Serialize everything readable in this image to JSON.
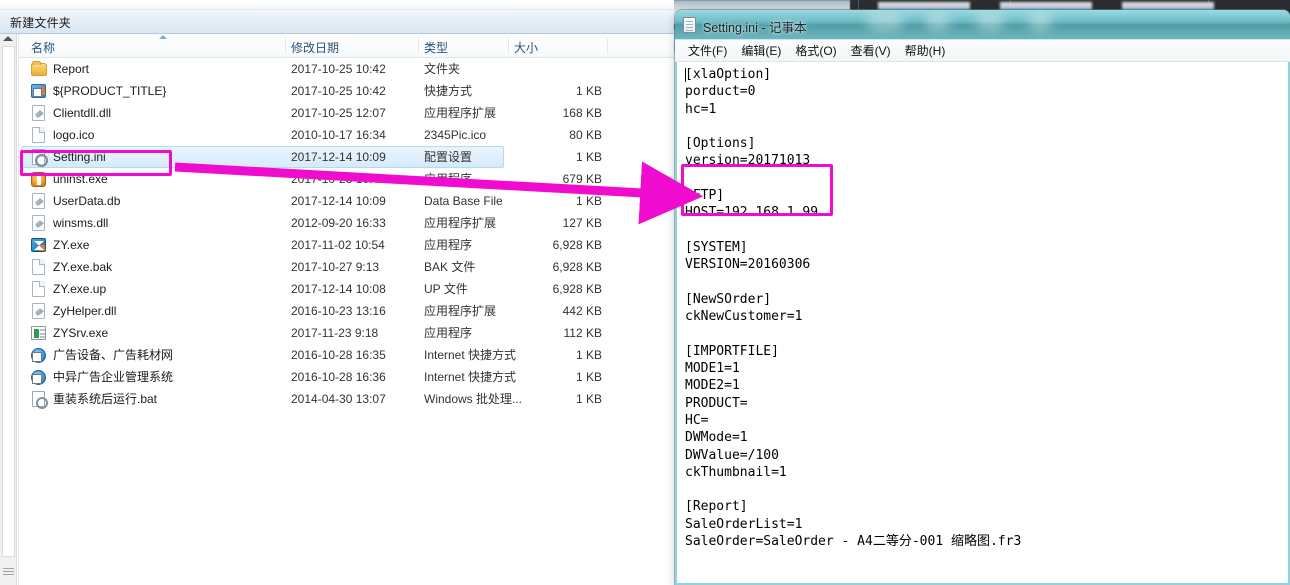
{
  "explorer": {
    "window_name": "file-explorer",
    "breadcrumb": "新建文件夹",
    "columns": [
      {
        "key": "name",
        "label": "名称"
      },
      {
        "key": "date",
        "label": "修改日期"
      },
      {
        "key": "type",
        "label": "类型"
      },
      {
        "key": "size",
        "label": "大小"
      }
    ],
    "sort_column": "名称",
    "sort_direction": "ascending",
    "rows": [
      {
        "icon": "folder-icon",
        "icon_class": "folder",
        "name": "Report",
        "date": "2017-10-25 10:42",
        "type": "文件夹",
        "size": "",
        "selected": false
      },
      {
        "icon": "shortcut-icon",
        "icon_class": "shortcut",
        "name": "${PRODUCT_TITLE}",
        "date": "2017-10-25 10:42",
        "type": "快捷方式",
        "size": "1 KB",
        "selected": false
      },
      {
        "icon": "dll-file-icon",
        "icon_class": "dll",
        "name": "Clientdll.dll",
        "date": "2017-10-25 12:07",
        "type": "应用程序扩展",
        "size": "168 KB",
        "selected": false
      },
      {
        "icon": "generic-file-icon",
        "icon_class": "doc",
        "name": "logo.ico",
        "date": "2010-10-17 16:34",
        "type": "2345Pic.ico",
        "size": "80 KB",
        "selected": false
      },
      {
        "icon": "ini-settings-icon",
        "icon_class": "gear",
        "name": "Setting.ini",
        "date": "2017-12-14 10:09",
        "type": "配置设置",
        "size": "1 KB",
        "selected": true
      },
      {
        "icon": "uninstall-app-icon",
        "icon_class": "app-uninst",
        "name": "uninst.exe",
        "date": "2017-10-25 10:42",
        "type": "应用程序",
        "size": "679 KB",
        "selected": false
      },
      {
        "icon": "dll-file-icon",
        "icon_class": "dll",
        "name": "UserData.db",
        "date": "2017-12-14 10:09",
        "type": "Data Base File",
        "size": "1 KB",
        "selected": false
      },
      {
        "icon": "dll-file-icon",
        "icon_class": "dll",
        "name": "winsms.dll",
        "date": "2012-09-20 16:33",
        "type": "应用程序扩展",
        "size": "127 KB",
        "selected": false
      },
      {
        "icon": "zy-app-icon",
        "icon_class": "zy",
        "name": "ZY.exe",
        "date": "2017-11-02 10:54",
        "type": "应用程序",
        "size": "6,928 KB",
        "selected": false
      },
      {
        "icon": "generic-file-icon",
        "icon_class": "doc",
        "name": "ZY.exe.bak",
        "date": "2017-10-27 9:13",
        "type": "BAK 文件",
        "size": "6,928 KB",
        "selected": false
      },
      {
        "icon": "generic-file-icon",
        "icon_class": "doc",
        "name": "ZY.exe.up",
        "date": "2017-12-14 10:08",
        "type": "UP 文件",
        "size": "6,928 KB",
        "selected": false
      },
      {
        "icon": "dll-file-icon",
        "icon_class": "dll",
        "name": "ZyHelper.dll",
        "date": "2016-10-23 13:16",
        "type": "应用程序扩展",
        "size": "442 KB",
        "selected": false
      },
      {
        "icon": "server-app-icon",
        "icon_class": "srv",
        "name": "ZYSrv.exe",
        "date": "2017-11-23 9:18",
        "type": "应用程序",
        "size": "112 KB",
        "selected": false
      },
      {
        "icon": "internet-shortcut-icon",
        "icon_class": "inet",
        "name": "广告设备、广告耗材网",
        "date": "2016-10-28 16:35",
        "type": "Internet 快捷方式",
        "size": "1 KB",
        "selected": false
      },
      {
        "icon": "internet-shortcut-icon",
        "icon_class": "inet",
        "name": "中异广告企业管理系统",
        "date": "2016-10-28 16:36",
        "type": "Internet 快捷方式",
        "size": "1 KB",
        "selected": false
      },
      {
        "icon": "batch-file-icon",
        "icon_class": "bat",
        "name": "重装系统后运行.bat",
        "date": "2014-04-30 13:07",
        "type": "Windows 批处理...",
        "size": "1 KB",
        "selected": false
      }
    ]
  },
  "notepad": {
    "window_name": "notepad-window",
    "title": "Setting.ini - 记事本",
    "icon": "notepad-document-icon",
    "menus": [
      {
        "label": "文件(F)",
        "name": "menu-file"
      },
      {
        "label": "编辑(E)",
        "name": "menu-edit"
      },
      {
        "label": "格式(O)",
        "name": "menu-format"
      },
      {
        "label": "查看(V)",
        "name": "menu-view"
      },
      {
        "label": "帮助(H)",
        "name": "menu-help"
      }
    ],
    "content": "[xlaOption]\nporduct=0\nhc=1\n\n[Options]\nversion=20171013\n\n[FTP]\nHOST=192.168.1.99\n\n[SYSTEM]\nVERSION=20160306\n\n[NewSOrder]\nckNewCustomer=1\n\n[IMPORTFILE]\nMODE1=1\nMODE2=1\nPRODUCT=\nHC=\nDWMode=1\nDWValue=/100\nckThumbnail=1\n\n[Report]\nSaleOrderList=1\nSaleOrder=SaleOrder - A4二等分-001 缩略图.fr3"
  },
  "annotations": {
    "highlight_color": "#ef0ccf",
    "boxes": [
      {
        "name": "highlight-box-setting-ini",
        "target": "Setting.ini"
      },
      {
        "name": "highlight-box-ftp-section",
        "target": "[FTP] HOST=192.168.1.99"
      }
    ],
    "arrow": {
      "name": "annotation-arrow",
      "from": "Setting.ini",
      "to": "[FTP] section"
    }
  },
  "selection": {
    "highlight_color": "#d5ebfb"
  }
}
